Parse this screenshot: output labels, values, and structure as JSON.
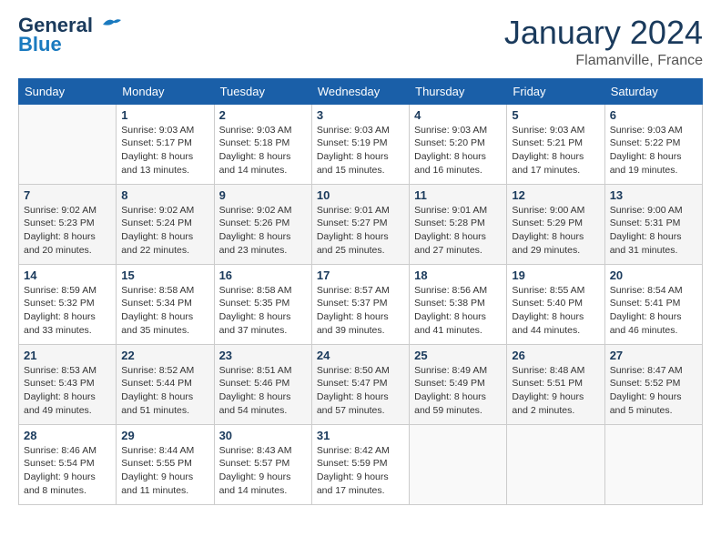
{
  "header": {
    "logo_line1": "General",
    "logo_line2": "Blue",
    "month": "January 2024",
    "location": "Flamanville, France"
  },
  "weekdays": [
    "Sunday",
    "Monday",
    "Tuesday",
    "Wednesday",
    "Thursday",
    "Friday",
    "Saturday"
  ],
  "weeks": [
    [
      {
        "day": "",
        "info": ""
      },
      {
        "day": "1",
        "info": "Sunrise: 9:03 AM\nSunset: 5:17 PM\nDaylight: 8 hours\nand 13 minutes."
      },
      {
        "day": "2",
        "info": "Sunrise: 9:03 AM\nSunset: 5:18 PM\nDaylight: 8 hours\nand 14 minutes."
      },
      {
        "day": "3",
        "info": "Sunrise: 9:03 AM\nSunset: 5:19 PM\nDaylight: 8 hours\nand 15 minutes."
      },
      {
        "day": "4",
        "info": "Sunrise: 9:03 AM\nSunset: 5:20 PM\nDaylight: 8 hours\nand 16 minutes."
      },
      {
        "day": "5",
        "info": "Sunrise: 9:03 AM\nSunset: 5:21 PM\nDaylight: 8 hours\nand 17 minutes."
      },
      {
        "day": "6",
        "info": "Sunrise: 9:03 AM\nSunset: 5:22 PM\nDaylight: 8 hours\nand 19 minutes."
      }
    ],
    [
      {
        "day": "7",
        "info": "Sunrise: 9:02 AM\nSunset: 5:23 PM\nDaylight: 8 hours\nand 20 minutes."
      },
      {
        "day": "8",
        "info": "Sunrise: 9:02 AM\nSunset: 5:24 PM\nDaylight: 8 hours\nand 22 minutes."
      },
      {
        "day": "9",
        "info": "Sunrise: 9:02 AM\nSunset: 5:26 PM\nDaylight: 8 hours\nand 23 minutes."
      },
      {
        "day": "10",
        "info": "Sunrise: 9:01 AM\nSunset: 5:27 PM\nDaylight: 8 hours\nand 25 minutes."
      },
      {
        "day": "11",
        "info": "Sunrise: 9:01 AM\nSunset: 5:28 PM\nDaylight: 8 hours\nand 27 minutes."
      },
      {
        "day": "12",
        "info": "Sunrise: 9:00 AM\nSunset: 5:29 PM\nDaylight: 8 hours\nand 29 minutes."
      },
      {
        "day": "13",
        "info": "Sunrise: 9:00 AM\nSunset: 5:31 PM\nDaylight: 8 hours\nand 31 minutes."
      }
    ],
    [
      {
        "day": "14",
        "info": "Sunrise: 8:59 AM\nSunset: 5:32 PM\nDaylight: 8 hours\nand 33 minutes."
      },
      {
        "day": "15",
        "info": "Sunrise: 8:58 AM\nSunset: 5:34 PM\nDaylight: 8 hours\nand 35 minutes."
      },
      {
        "day": "16",
        "info": "Sunrise: 8:58 AM\nSunset: 5:35 PM\nDaylight: 8 hours\nand 37 minutes."
      },
      {
        "day": "17",
        "info": "Sunrise: 8:57 AM\nSunset: 5:37 PM\nDaylight: 8 hours\nand 39 minutes."
      },
      {
        "day": "18",
        "info": "Sunrise: 8:56 AM\nSunset: 5:38 PM\nDaylight: 8 hours\nand 41 minutes."
      },
      {
        "day": "19",
        "info": "Sunrise: 8:55 AM\nSunset: 5:40 PM\nDaylight: 8 hours\nand 44 minutes."
      },
      {
        "day": "20",
        "info": "Sunrise: 8:54 AM\nSunset: 5:41 PM\nDaylight: 8 hours\nand 46 minutes."
      }
    ],
    [
      {
        "day": "21",
        "info": "Sunrise: 8:53 AM\nSunset: 5:43 PM\nDaylight: 8 hours\nand 49 minutes."
      },
      {
        "day": "22",
        "info": "Sunrise: 8:52 AM\nSunset: 5:44 PM\nDaylight: 8 hours\nand 51 minutes."
      },
      {
        "day": "23",
        "info": "Sunrise: 8:51 AM\nSunset: 5:46 PM\nDaylight: 8 hours\nand 54 minutes."
      },
      {
        "day": "24",
        "info": "Sunrise: 8:50 AM\nSunset: 5:47 PM\nDaylight: 8 hours\nand 57 minutes."
      },
      {
        "day": "25",
        "info": "Sunrise: 8:49 AM\nSunset: 5:49 PM\nDaylight: 8 hours\nand 59 minutes."
      },
      {
        "day": "26",
        "info": "Sunrise: 8:48 AM\nSunset: 5:51 PM\nDaylight: 9 hours\nand 2 minutes."
      },
      {
        "day": "27",
        "info": "Sunrise: 8:47 AM\nSunset: 5:52 PM\nDaylight: 9 hours\nand 5 minutes."
      }
    ],
    [
      {
        "day": "28",
        "info": "Sunrise: 8:46 AM\nSunset: 5:54 PM\nDaylight: 9 hours\nand 8 minutes."
      },
      {
        "day": "29",
        "info": "Sunrise: 8:44 AM\nSunset: 5:55 PM\nDaylight: 9 hours\nand 11 minutes."
      },
      {
        "day": "30",
        "info": "Sunrise: 8:43 AM\nSunset: 5:57 PM\nDaylight: 9 hours\nand 14 minutes."
      },
      {
        "day": "31",
        "info": "Sunrise: 8:42 AM\nSunset: 5:59 PM\nDaylight: 9 hours\nand 17 minutes."
      },
      {
        "day": "",
        "info": ""
      },
      {
        "day": "",
        "info": ""
      },
      {
        "day": "",
        "info": ""
      }
    ]
  ]
}
